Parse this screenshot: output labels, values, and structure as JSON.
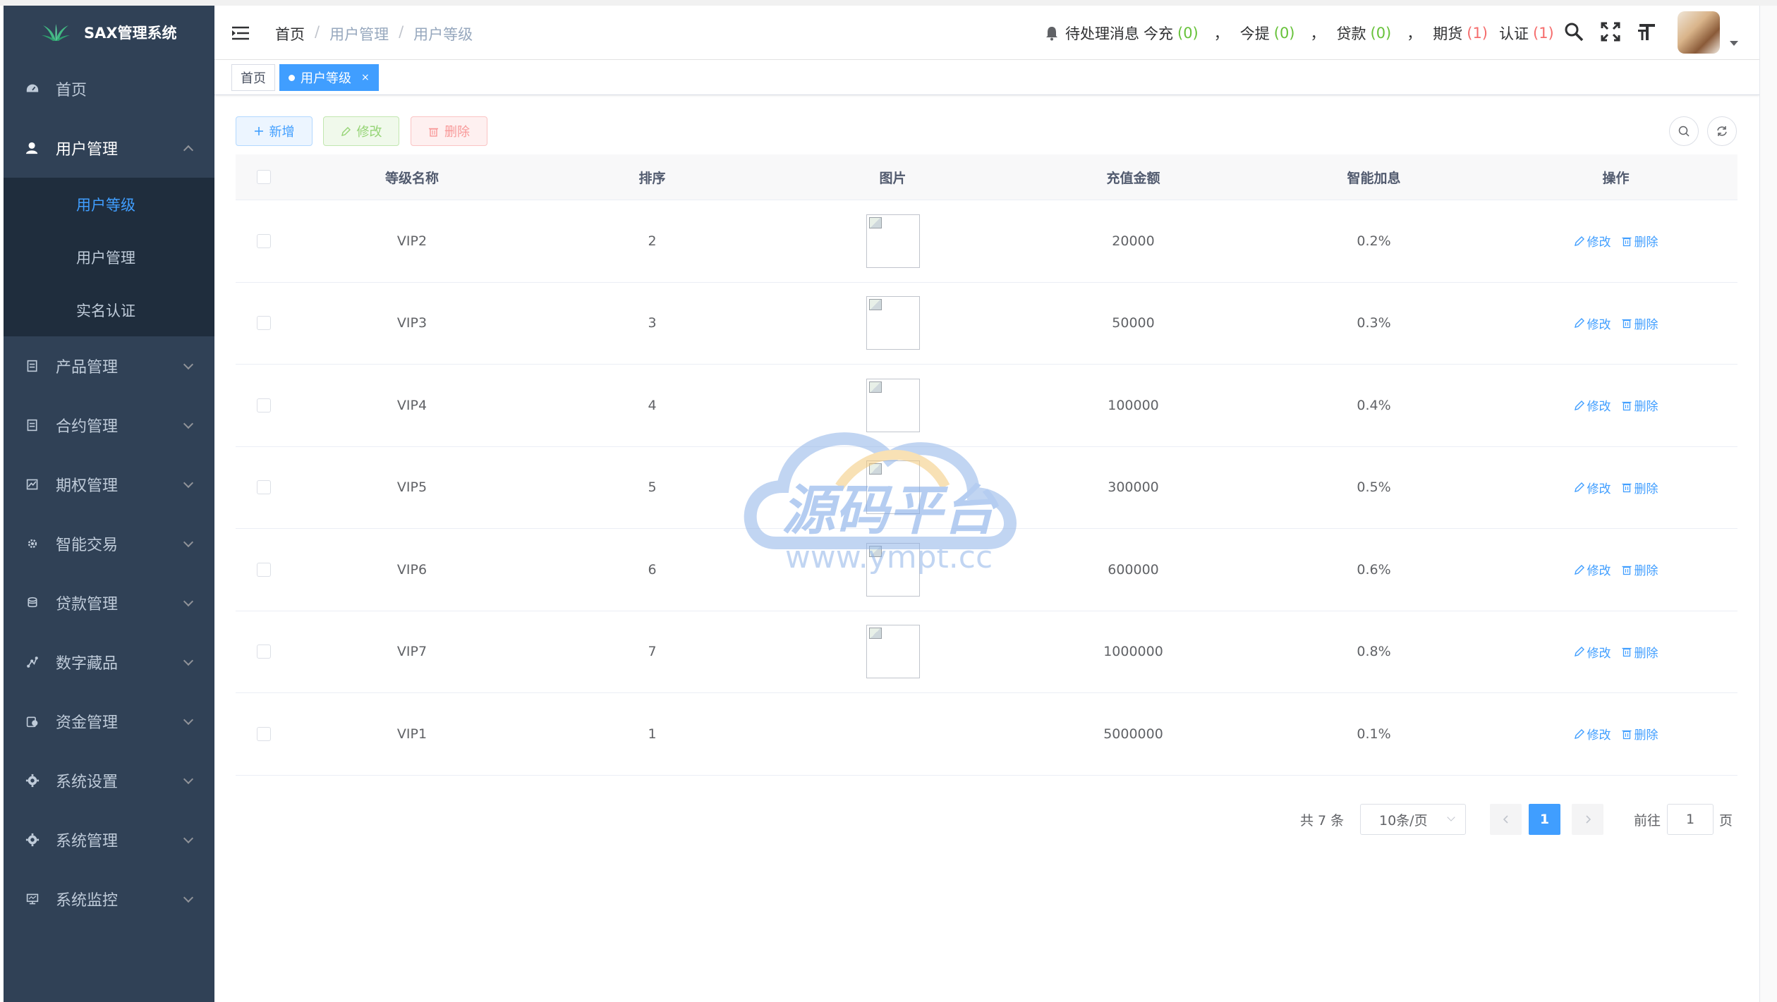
{
  "sidebar": {
    "logo_text": "SAX管理系统",
    "home": "首页",
    "user_mgmt": "用户管理",
    "sub_items": [
      "用户等级",
      "用户管理",
      "实名认证"
    ],
    "items": [
      "产品管理",
      "合约管理",
      "期权管理",
      "智能交易",
      "贷款管理",
      "数字藏品",
      "资金管理",
      "系统设置",
      "系统管理",
      "系统监控"
    ]
  },
  "navbar": {
    "breadcrumb": [
      "首页",
      "用户管理",
      "用户等级"
    ],
    "separator": "/",
    "notice_label": "待处理消息",
    "notices": [
      {
        "label": "今充",
        "value": "(0)",
        "color": "#67c23a"
      },
      {
        "label": "今提",
        "value": "(0)",
        "color": "#67c23a"
      },
      {
        "label": "贷款",
        "value": "(0)",
        "color": "#67c23a"
      },
      {
        "label": "期货",
        "value": "(1)",
        "color": "#f56c6c"
      },
      {
        "label": "认证",
        "value": "(1)",
        "color": "#f56c6c"
      }
    ],
    "comma": "，"
  },
  "tags": {
    "home": "首页",
    "active": "用户等级",
    "close": "×"
  },
  "toolbar": {
    "add": "新增",
    "edit": "修改",
    "delete": "删除"
  },
  "table": {
    "headers": [
      "等级名称",
      "排序",
      "图片",
      "充值金额",
      "智能加息",
      "操作"
    ],
    "rows": [
      {
        "name": "VIP2",
        "sort": "2",
        "has_image": true,
        "amount": "20000",
        "rate": "0.2%"
      },
      {
        "name": "VIP3",
        "sort": "3",
        "has_image": true,
        "amount": "50000",
        "rate": "0.3%"
      },
      {
        "name": "VIP4",
        "sort": "4",
        "has_image": true,
        "amount": "100000",
        "rate": "0.4%"
      },
      {
        "name": "VIP5",
        "sort": "5",
        "has_image": true,
        "amount": "300000",
        "rate": "0.5%"
      },
      {
        "name": "VIP6",
        "sort": "6",
        "has_image": true,
        "amount": "600000",
        "rate": "0.6%"
      },
      {
        "name": "VIP7",
        "sort": "7",
        "has_image": true,
        "amount": "1000000",
        "rate": "0.8%"
      },
      {
        "name": "VIP1",
        "sort": "1",
        "has_image": false,
        "amount": "5000000",
        "rate": "0.1%"
      }
    ],
    "edit_link": "修改",
    "delete_link": "删除"
  },
  "pagination": {
    "total": "共 7 条",
    "page_size": "10条/页",
    "current_page": "1",
    "goto_label": "前往",
    "goto_value": "1",
    "page_suffix": "页"
  },
  "watermark": {
    "title": "源码平台",
    "url": "www.ympt.cc"
  },
  "colors": {
    "sidebar_bg": "#304156",
    "submenu_bg": "#1f2d3d",
    "primary": "#409eff",
    "success": "#67c23a",
    "danger": "#f56c6c"
  }
}
